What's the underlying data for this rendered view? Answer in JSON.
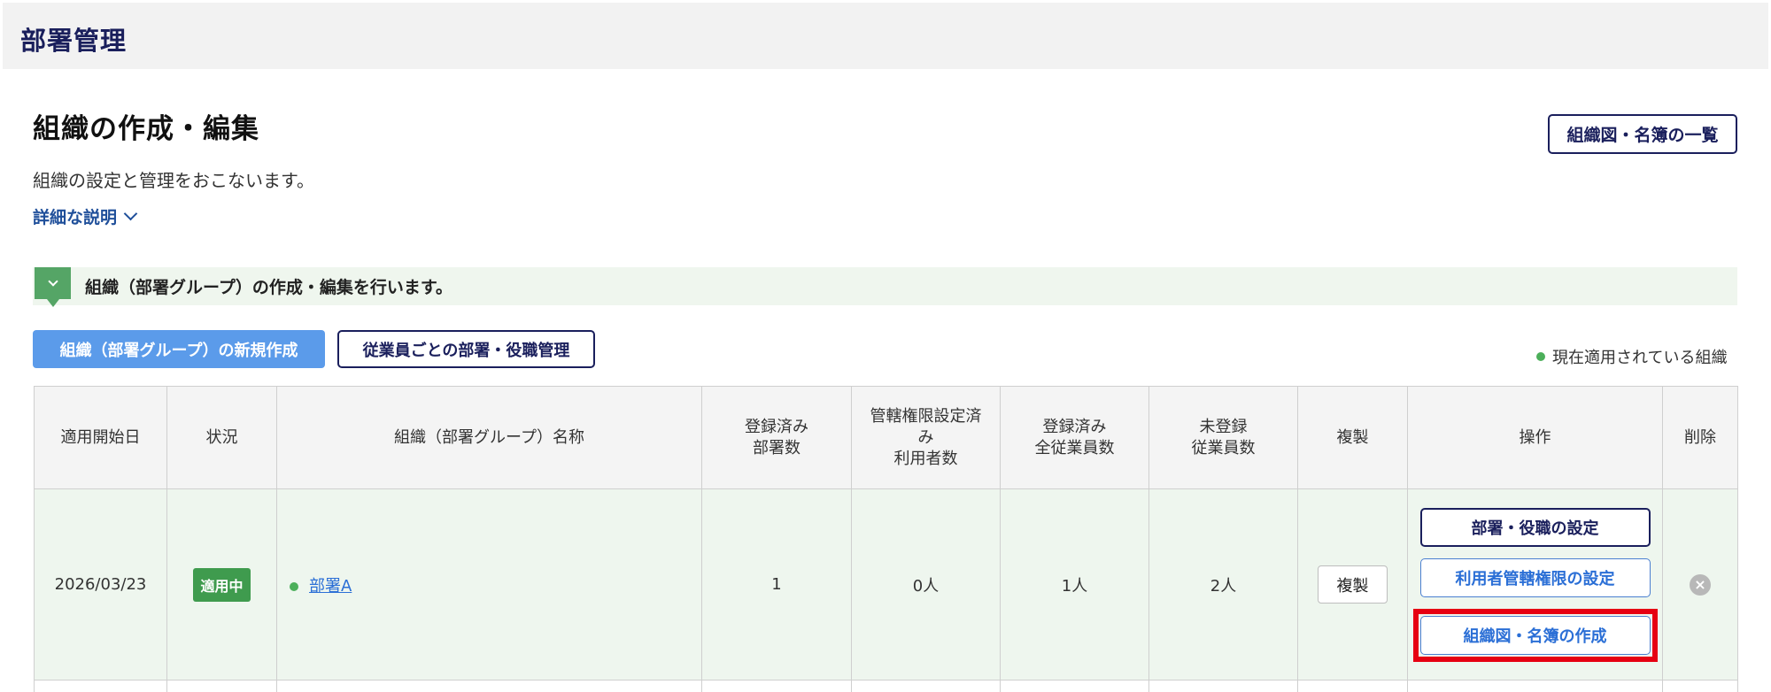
{
  "header": {
    "title": "部署管理"
  },
  "section": {
    "title": "組織の作成・編集",
    "description": "組織の設定と管理をおこないます。",
    "detail_link": "詳細な説明",
    "org_list_button": "組織図・名簿の一覧"
  },
  "info_bar": {
    "text": "組織（部署グループ）の作成・編集を行います。"
  },
  "actions": {
    "create_button": "組織（部署グループ）の新規作成",
    "employee_button": "従業員ごとの部署・役職管理"
  },
  "legend": {
    "text": "現在適用されている組織"
  },
  "table": {
    "headers": [
      "適用開始日",
      "状況",
      "組織（部署グループ）名称",
      "登録済み\n部署数",
      "管轄権限設定済\nみ\n利用者数",
      "登録済み\n全従業員数",
      "未登録\n従業員数",
      "複製",
      "操作",
      "削除"
    ],
    "rows": [
      {
        "start_date": "2026/03/23",
        "status": "適用中",
        "name": "部署A",
        "dept_count": "1",
        "users_count": "0人",
        "registered_employees": "1人",
        "unregistered_employees": "2人",
        "copy_label": "複製",
        "ops": {
          "dept_settings": "部署・役職の設定",
          "permission_settings": "利用者管轄権限の設定",
          "create_chart": "組織図・名簿の作成"
        }
      }
    ]
  },
  "colors": {
    "navy": "#1a1f5c",
    "primary_blue": "#5b9bea",
    "active_green": "#3f9b4e",
    "highlight_red": "#e60012"
  }
}
